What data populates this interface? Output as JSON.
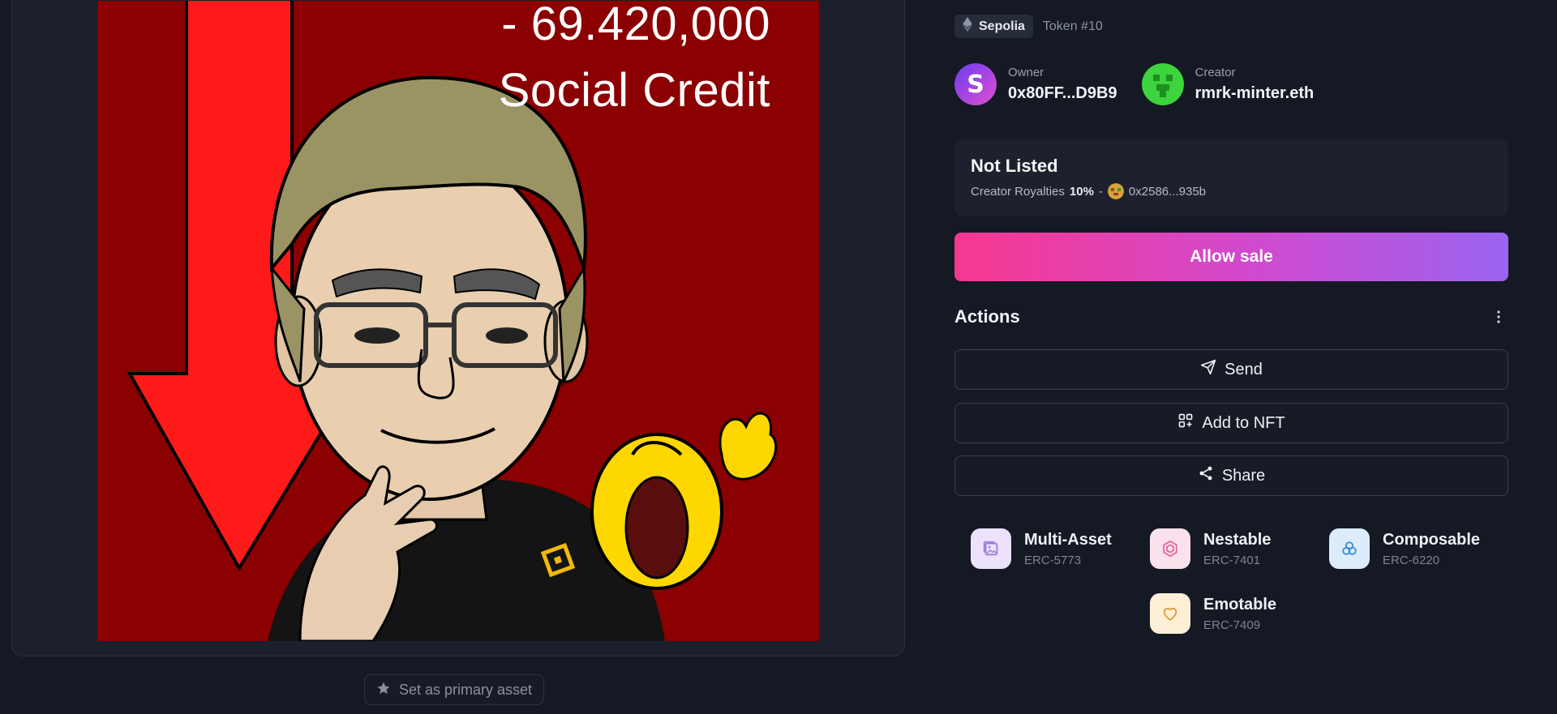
{
  "artwork": {
    "line1": "- 69.420,000",
    "line2": "Social Credit",
    "set_primary_label": "Set as primary asset"
  },
  "token": {
    "network": "Sepolia",
    "token_id": "Token #10"
  },
  "owner": {
    "role": "Owner",
    "value": "0x80FF...D9B9"
  },
  "creator": {
    "role": "Creator",
    "value": "rmrk-minter.eth"
  },
  "listing": {
    "status": "Not Listed",
    "royalties_label": "Creator Royalties",
    "royalties_value": "10%",
    "separator": "-",
    "royalty_address": "0x2586...935b"
  },
  "allow_sale_label": "Allow sale",
  "actions": {
    "title": "Actions",
    "send": "Send",
    "add_to_nft": "Add to NFT",
    "share": "Share"
  },
  "features": [
    {
      "name": "Multi-Asset",
      "standard": "ERC-5773",
      "icon": "multi-asset-icon",
      "color": "#9b7fd6"
    },
    {
      "name": "Nestable",
      "standard": "ERC-7401",
      "icon": "nestable-icon",
      "color": "#e06aa0"
    },
    {
      "name": "Composable",
      "standard": "ERC-6220",
      "icon": "composable-icon",
      "color": "#3f8fd8"
    },
    {
      "name": "Emotable",
      "standard": "ERC-7409",
      "icon": "emotable-icon",
      "color": "#e39a3a"
    }
  ],
  "colors": {
    "background": "#151924",
    "panel": "#1c212d",
    "allow_gradient_start": "#f6388f",
    "allow_gradient_end": "#9a64f0",
    "art_background": "#8b0000"
  }
}
